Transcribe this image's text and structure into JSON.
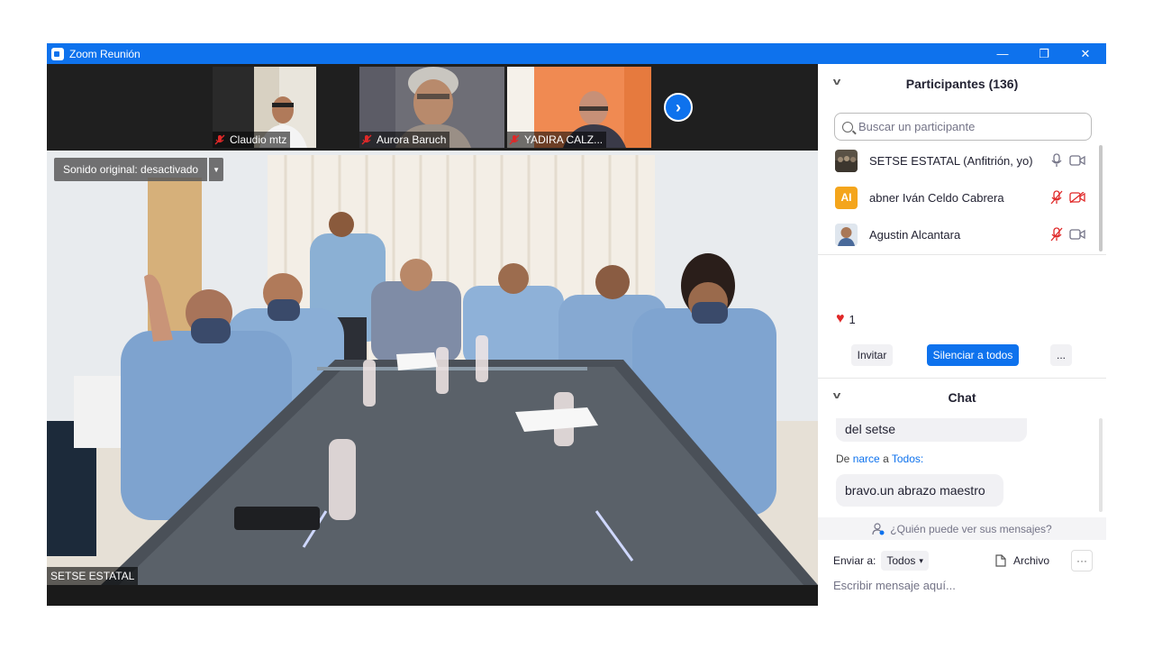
{
  "window": {
    "title": "Zoom Reunión",
    "controls": {
      "minimize": "—",
      "restore": "❐",
      "close": "✕"
    }
  },
  "thumbnails": [
    {
      "name": "Claudio mtz",
      "muted": true
    },
    {
      "name": "Aurora Baruch",
      "muted": true
    },
    {
      "name": "YADIRA CALZ...",
      "muted": true
    }
  ],
  "next_page_icon": "chevron-right",
  "main_video": {
    "sound_label": "Sonido original: desactivado",
    "speaker_name": "SETSE ESTATAL"
  },
  "participants_panel": {
    "title": "Participantes (136)",
    "search_placeholder": "Buscar un participante",
    "participants": [
      {
        "name": "SETSE ESTATAL (Anfitrión, yo)",
        "initials": "",
        "mic_muted": false,
        "video_off": false
      },
      {
        "name": "abner Iván Celdo Cabrera",
        "initials": "AI",
        "mic_muted": true,
        "video_off": true
      },
      {
        "name": "Agustin Alcantara",
        "initials": "",
        "mic_muted": true,
        "video_off": false
      }
    ],
    "reaction": {
      "icon": "heart",
      "count": "1"
    },
    "buttons": {
      "invite": "Invitar",
      "mute_all": "Silenciar a todos",
      "more": "..."
    }
  },
  "chat_panel": {
    "title": "Chat",
    "messages": [
      {
        "text": "del setse"
      },
      {
        "from_prefix": "De",
        "sender": "narce",
        "to_word": "a",
        "recipient": "Todos:",
        "text": "bravo.un abrazo maestro"
      }
    ],
    "who_can_see": "¿Quién puede ver sus mensajes?",
    "send_to_label": "Enviar a:",
    "send_to_value": "Todos",
    "file_label": "Archivo",
    "more_label": "···",
    "input_placeholder": "Escribir mensaje aquí..."
  },
  "colors": {
    "accent": "#0e72ed",
    "avatar_initials_bg": "#f4a51c",
    "muted_red": "#e02828",
    "dark_bg": "#1a1a1a"
  }
}
